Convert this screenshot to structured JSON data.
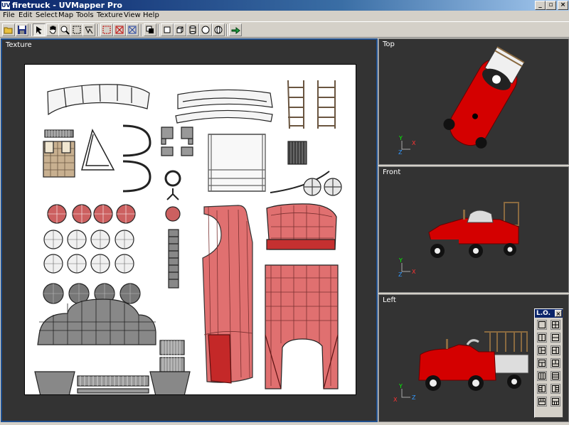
{
  "window": {
    "title": "firetruck - UVMapper Pro",
    "app_icon": "UV",
    "controls": {
      "minimize": "_",
      "maximize": "▫",
      "close": "×"
    }
  },
  "menu": {
    "items": [
      "File",
      "Edit",
      "Select",
      "Map",
      "Tools",
      "Texture",
      "View",
      "Help"
    ]
  },
  "toolbar": {
    "buttons": [
      "open-icon",
      "save-icon",
      "select-arrow-icon",
      "hand-pan-icon",
      "zoom-icon",
      "box-select-icon",
      "lasso-icon",
      "select-region-icon",
      "deselect-icon",
      "invert-select-icon",
      "copy-icon",
      "planar-icon",
      "box-map-icon",
      "cylinder-icon",
      "sphere-icon",
      "cylinder-cap-icon",
      "export-icon"
    ]
  },
  "panels": {
    "texture": "Texture",
    "top": "Top",
    "front": "Front",
    "left": "Left"
  },
  "lo_palette": {
    "title": "L.O."
  },
  "colors": {
    "title_start": "#0a246a",
    "title_end": "#a6caf0",
    "viewport_bg": "#333333",
    "truck_red": "#d40000",
    "uv_red": "#e06a6a",
    "active_border": "#1f4f8f"
  }
}
